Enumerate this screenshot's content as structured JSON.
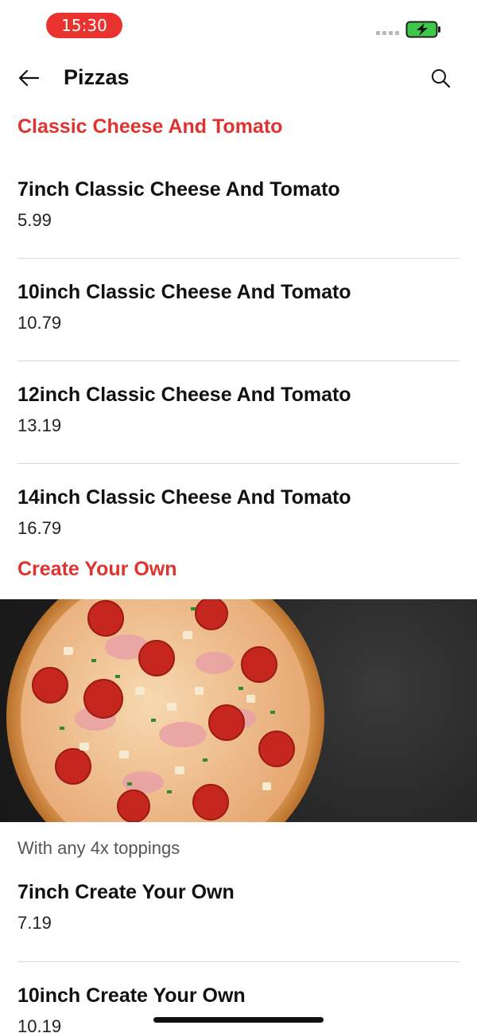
{
  "status_bar": {
    "time": "15:30"
  },
  "header": {
    "title": "Pizzas"
  },
  "sections": [
    {
      "title": "Classic Cheese And Tomato",
      "items": [
        {
          "name": "7inch Classic Cheese And Tomato",
          "price": "5.99"
        },
        {
          "name": "10inch Classic Cheese And Tomato",
          "price": "10.79"
        },
        {
          "name": "12inch Classic Cheese And Tomato",
          "price": "13.19"
        },
        {
          "name": "14inch Classic Cheese And Tomato",
          "price": "16.79"
        }
      ]
    },
    {
      "title": "Create Your Own",
      "description": "With any 4x toppings",
      "items": [
        {
          "name": "7inch Create Your Own",
          "price": "7.19"
        },
        {
          "name": "10inch Create Your Own",
          "price": "10.19"
        }
      ]
    }
  ],
  "colors": {
    "accent": "#e0322e",
    "status_pill": "#e8332f",
    "battery_green": "#3dc84a"
  },
  "icons": [
    "back-arrow-icon",
    "search-icon",
    "battery-charging-icon",
    "signal-icon"
  ]
}
